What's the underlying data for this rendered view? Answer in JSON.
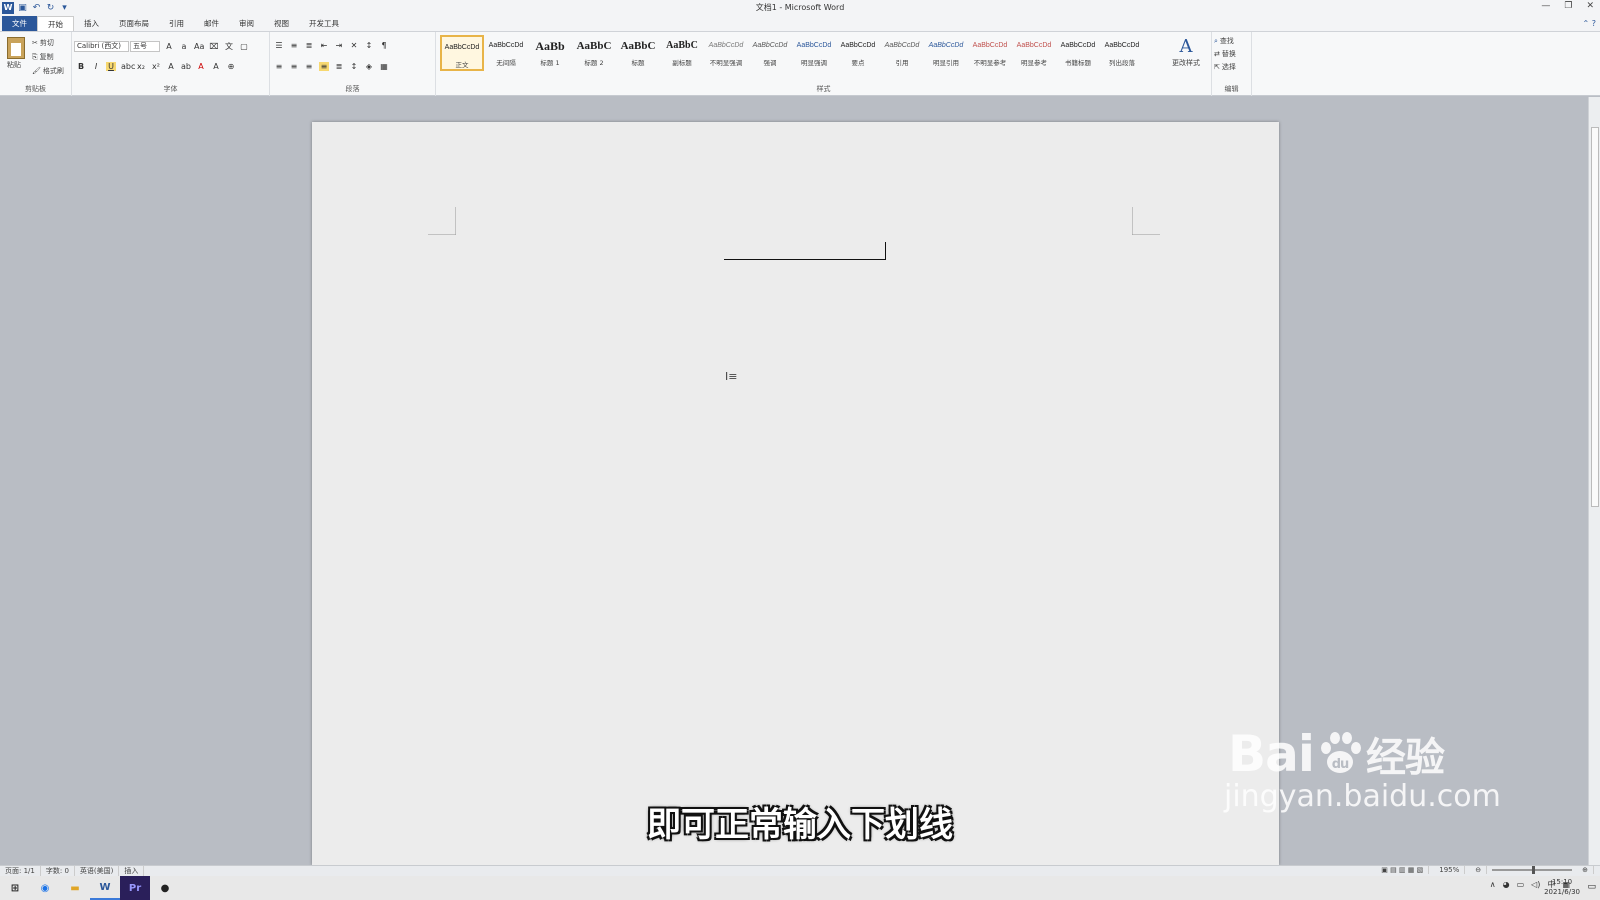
{
  "window": {
    "title": "文档1 - Microsoft Word"
  },
  "tabs": [
    "文件",
    "开始",
    "插入",
    "页面布局",
    "引用",
    "邮件",
    "审阅",
    "视图",
    "开发工具"
  ],
  "clipboard": {
    "paste": "粘贴",
    "cut": "剪切",
    "copy": "复制",
    "format_painter": "格式刷",
    "label": "剪贴板"
  },
  "font": {
    "name": "Calibri (西文)",
    "size": "五号",
    "label": "字体"
  },
  "paragraph": {
    "label": "段落"
  },
  "styles": {
    "label": "样式",
    "items": [
      {
        "preview": "AaBbCcDd",
        "name": "正文"
      },
      {
        "preview": "AaBbCcDd",
        "name": "无间隔"
      },
      {
        "preview": "AaBb",
        "name": "标题 1"
      },
      {
        "preview": "AaBbC",
        "name": "标题 2"
      },
      {
        "preview": "AaBbC",
        "name": "标题"
      },
      {
        "preview": "AaBbC",
        "name": "副标题"
      },
      {
        "preview": "AaBbCcDd",
        "name": "不明显强调"
      },
      {
        "preview": "AaBbCcDd",
        "name": "强调"
      },
      {
        "preview": "AaBbCcDd",
        "name": "明显强调"
      },
      {
        "preview": "AaBbCcDd",
        "name": "要点"
      },
      {
        "preview": "AaBbCcDd",
        "name": "引用"
      },
      {
        "preview": "AaBbCcDd",
        "name": "明显引用"
      },
      {
        "preview": "AaBbCcDd",
        "name": "不明显参考"
      },
      {
        "preview": "AaBbCcDd",
        "name": "明显参考"
      },
      {
        "preview": "AaBbCcDd",
        "name": "书籍标题"
      },
      {
        "preview": "AaBbCcDd",
        "name": "列出段落"
      }
    ],
    "change_styles": "更改样式"
  },
  "editing": {
    "find": "查找",
    "replace": "替换",
    "select": "选择",
    "label": "编辑"
  },
  "status": {
    "page": "页面: 1/1",
    "words": "字数: 0",
    "lang": "英语(美国)",
    "mode": "插入",
    "zoom": "195%"
  },
  "clock": {
    "time": "15:10",
    "date": "2021/6/30"
  },
  "subtitle": "即可正常输入下划线",
  "watermark": {
    "brand": "Bai",
    "brand2": "du",
    "cn": "经验",
    "url": "jingyan.baidu.com"
  },
  "colors": {
    "accent": "#2b579a",
    "selected_style": "#e8b448"
  }
}
